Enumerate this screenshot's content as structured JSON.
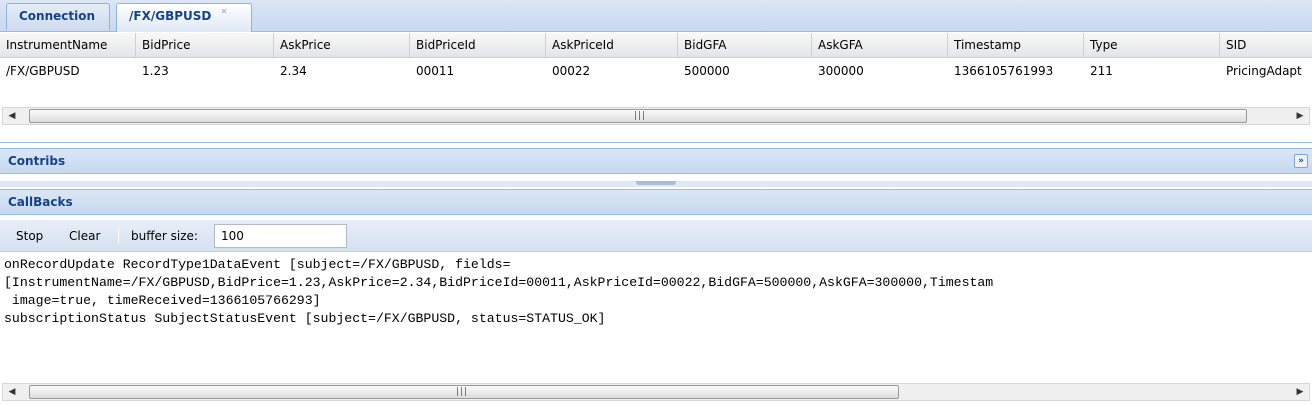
{
  "tabs": [
    {
      "label": "Connection",
      "active": false
    },
    {
      "label": "/FX/GBPUSD",
      "active": true
    }
  ],
  "grid": {
    "columns": [
      "InstrumentName",
      "BidPrice",
      "AskPrice",
      "BidPriceId",
      "AskPriceId",
      "BidGFA",
      "AskGFA",
      "Timestamp",
      "Type",
      "SID"
    ],
    "rows": [
      [
        "/FX/GBPUSD",
        "1.23",
        "2.34",
        "00011",
        "00022",
        "500000",
        "300000",
        "1366105761993",
        "211",
        "PricingAdapt"
      ]
    ]
  },
  "panels": {
    "contribs_title": "Contribs",
    "callbacks_title": "CallBacks"
  },
  "toolbar": {
    "stop_label": "Stop",
    "clear_label": "Clear",
    "buffer_label": "buffer size:",
    "buffer_value": "100"
  },
  "log": [
    "onRecordUpdate RecordType1DataEvent [subject=/FX/GBPUSD, fields=",
    "[InstrumentName=/FX/GBPUSD,BidPrice=1.23,AskPrice=2.34,BidPriceId=00011,AskPriceId=00022,BidGFA=500000,AskGFA=300000,Timestam",
    " image=true, timeReceived=1366105766293]",
    "subscriptionStatus SubjectStatusEvent [subject=/FX/GBPUSD, status=STATUS_OK]"
  ],
  "icons": {
    "tab_close": "close-icon",
    "collapse": "double-chevron-down-icon",
    "scroll_left": "arrow-left-icon",
    "scroll_right": "arrow-right-icon"
  },
  "colors": {
    "header_text": "#15428b",
    "panel_border": "#99bbe8"
  }
}
